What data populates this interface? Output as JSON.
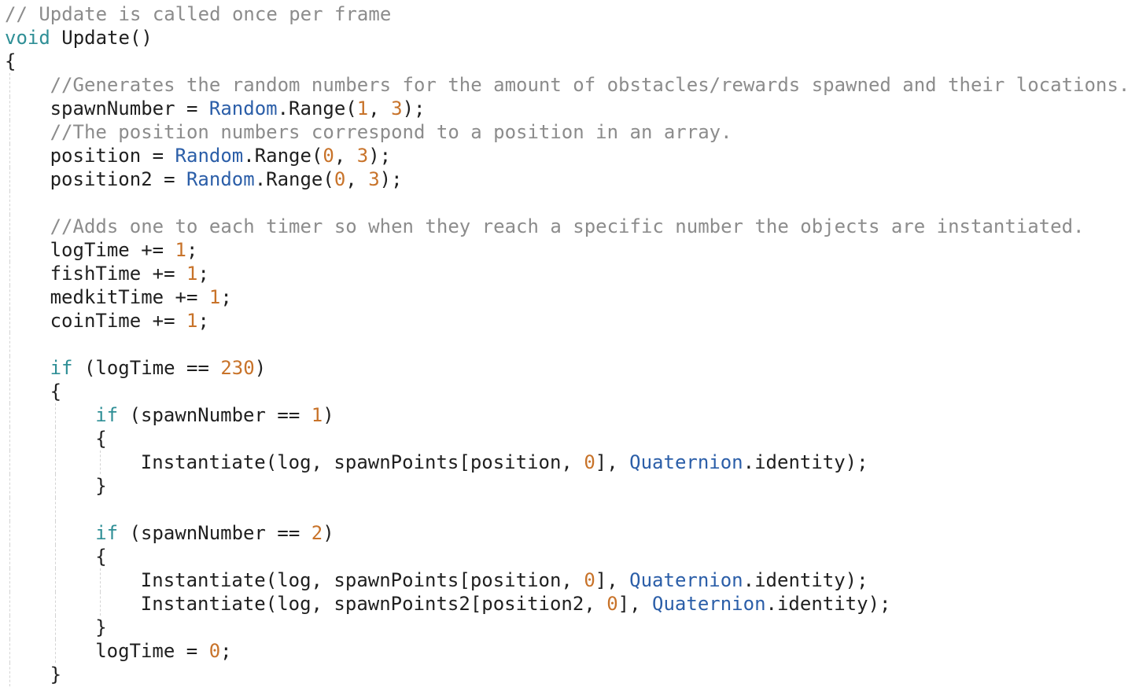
{
  "colors": {
    "background": "#ffffff",
    "text": "#1f1f1f",
    "comment": "#8c8c8c",
    "keyword": "#2f8f96",
    "type": "#2b5ea8",
    "number": "#c8732a",
    "indent_guide": "#d3d3d3"
  },
  "code": {
    "language": "C#",
    "lines": [
      {
        "indent": 0,
        "tokens": [
          {
            "t": "// Update is called once per frame",
            "k": "comment"
          }
        ]
      },
      {
        "indent": 0,
        "tokens": [
          {
            "t": "void",
            "k": "keyword"
          },
          {
            "t": " Update()",
            "k": "plain"
          }
        ]
      },
      {
        "indent": 0,
        "tokens": [
          {
            "t": "{",
            "k": "plain"
          }
        ]
      },
      {
        "indent": 1,
        "tokens": [
          {
            "t": "//Generates the random numbers for the amount of obstacles/rewards spawned and their locations.",
            "k": "comment"
          }
        ]
      },
      {
        "indent": 1,
        "tokens": [
          {
            "t": "spawnNumber = ",
            "k": "plain"
          },
          {
            "t": "Random",
            "k": "type"
          },
          {
            "t": ".Range(",
            "k": "plain"
          },
          {
            "t": "1",
            "k": "number"
          },
          {
            "t": ", ",
            "k": "plain"
          },
          {
            "t": "3",
            "k": "number"
          },
          {
            "t": ");",
            "k": "plain"
          }
        ]
      },
      {
        "indent": 1,
        "tokens": [
          {
            "t": "//The position numbers correspond to a position in an array.",
            "k": "comment"
          }
        ]
      },
      {
        "indent": 1,
        "tokens": [
          {
            "t": "position = ",
            "k": "plain"
          },
          {
            "t": "Random",
            "k": "type"
          },
          {
            "t": ".Range(",
            "k": "plain"
          },
          {
            "t": "0",
            "k": "number"
          },
          {
            "t": ", ",
            "k": "plain"
          },
          {
            "t": "3",
            "k": "number"
          },
          {
            "t": ");",
            "k": "plain"
          }
        ]
      },
      {
        "indent": 1,
        "tokens": [
          {
            "t": "position2 = ",
            "k": "plain"
          },
          {
            "t": "Random",
            "k": "type"
          },
          {
            "t": ".Range(",
            "k": "plain"
          },
          {
            "t": "0",
            "k": "number"
          },
          {
            "t": ", ",
            "k": "plain"
          },
          {
            "t": "3",
            "k": "number"
          },
          {
            "t": ");",
            "k": "plain"
          }
        ]
      },
      {
        "indent": 1,
        "tokens": []
      },
      {
        "indent": 1,
        "tokens": [
          {
            "t": "//Adds one to each timer so when they reach a specific number the objects are instantiated.",
            "k": "comment"
          }
        ]
      },
      {
        "indent": 1,
        "tokens": [
          {
            "t": "logTime += ",
            "k": "plain"
          },
          {
            "t": "1",
            "k": "number"
          },
          {
            "t": ";",
            "k": "plain"
          }
        ]
      },
      {
        "indent": 1,
        "tokens": [
          {
            "t": "fishTime += ",
            "k": "plain"
          },
          {
            "t": "1",
            "k": "number"
          },
          {
            "t": ";",
            "k": "plain"
          }
        ]
      },
      {
        "indent": 1,
        "tokens": [
          {
            "t": "medkitTime += ",
            "k": "plain"
          },
          {
            "t": "1",
            "k": "number"
          },
          {
            "t": ";",
            "k": "plain"
          }
        ]
      },
      {
        "indent": 1,
        "tokens": [
          {
            "t": "coinTime += ",
            "k": "plain"
          },
          {
            "t": "1",
            "k": "number"
          },
          {
            "t": ";",
            "k": "plain"
          }
        ]
      },
      {
        "indent": 1,
        "tokens": []
      },
      {
        "indent": 1,
        "tokens": [
          {
            "t": "if",
            "k": "keyword"
          },
          {
            "t": " (logTime == ",
            "k": "plain"
          },
          {
            "t": "230",
            "k": "number"
          },
          {
            "t": ")",
            "k": "plain"
          }
        ]
      },
      {
        "indent": 1,
        "tokens": [
          {
            "t": "{",
            "k": "plain"
          }
        ]
      },
      {
        "indent": 2,
        "tokens": [
          {
            "t": "if",
            "k": "keyword"
          },
          {
            "t": " (spawnNumber == ",
            "k": "plain"
          },
          {
            "t": "1",
            "k": "number"
          },
          {
            "t": ")",
            "k": "plain"
          }
        ]
      },
      {
        "indent": 2,
        "tokens": [
          {
            "t": "{",
            "k": "plain"
          }
        ]
      },
      {
        "indent": 3,
        "tokens": [
          {
            "t": "Instantiate(log, spawnPoints[position, ",
            "k": "plain"
          },
          {
            "t": "0",
            "k": "number"
          },
          {
            "t": "], ",
            "k": "plain"
          },
          {
            "t": "Quaternion",
            "k": "type"
          },
          {
            "t": ".identity);",
            "k": "plain"
          }
        ]
      },
      {
        "indent": 2,
        "tokens": [
          {
            "t": "}",
            "k": "plain"
          }
        ]
      },
      {
        "indent": 2,
        "tokens": []
      },
      {
        "indent": 2,
        "tokens": [
          {
            "t": "if",
            "k": "keyword"
          },
          {
            "t": " (spawnNumber == ",
            "k": "plain"
          },
          {
            "t": "2",
            "k": "number"
          },
          {
            "t": ")",
            "k": "plain"
          }
        ]
      },
      {
        "indent": 2,
        "tokens": [
          {
            "t": "{",
            "k": "plain"
          }
        ]
      },
      {
        "indent": 3,
        "tokens": [
          {
            "t": "Instantiate(log, spawnPoints[position, ",
            "k": "plain"
          },
          {
            "t": "0",
            "k": "number"
          },
          {
            "t": "], ",
            "k": "plain"
          },
          {
            "t": "Quaternion",
            "k": "type"
          },
          {
            "t": ".identity);",
            "k": "plain"
          }
        ]
      },
      {
        "indent": 3,
        "tokens": [
          {
            "t": "Instantiate(log, spawnPoints2[position2, ",
            "k": "plain"
          },
          {
            "t": "0",
            "k": "number"
          },
          {
            "t": "], ",
            "k": "plain"
          },
          {
            "t": "Quaternion",
            "k": "type"
          },
          {
            "t": ".identity);",
            "k": "plain"
          }
        ]
      },
      {
        "indent": 2,
        "tokens": [
          {
            "t": "}",
            "k": "plain"
          }
        ]
      },
      {
        "indent": 2,
        "tokens": [
          {
            "t": "logTime = ",
            "k": "plain"
          },
          {
            "t": "0",
            "k": "number"
          },
          {
            "t": ";",
            "k": "plain"
          }
        ]
      },
      {
        "indent": 1,
        "tokens": [
          {
            "t": "}",
            "k": "plain"
          }
        ]
      }
    ]
  }
}
